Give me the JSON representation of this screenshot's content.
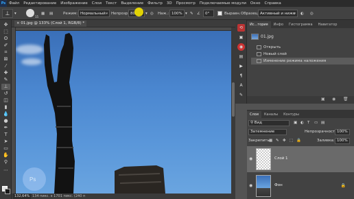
{
  "app": {
    "logo": "Ps"
  },
  "menu": [
    "Файл",
    "Редактирование",
    "Изображение",
    "Слои",
    "Текст",
    "Выделение",
    "Фильтр",
    "3D",
    "Просмотр",
    "Подключаемые модули",
    "Окно",
    "Справка"
  ],
  "options": {
    "brush_size": "15",
    "mode_label": "Режим:",
    "mode_value": "Нормальный",
    "opacity_label": "Непрозр.:",
    "opacity_value": "80",
    "flow_label": "Наж.:",
    "flow_value": "100%",
    "angle_value": "0°",
    "aligned_label": "Выравн.",
    "sample_label": "Образец:",
    "sample_value": "Активный и ниже"
  },
  "document": {
    "tab_title": "01.jpg @ 133% (Слой 1, RGB/8) *",
    "zoom": "132,64%",
    "info": "134 пикс. x 1701 пикс. (240 п"
  },
  "history": {
    "tabs": [
      "Ис...тория",
      "Инфо",
      "Гистограмма",
      "Навигатор"
    ],
    "snapshot": "01.jpg",
    "items": [
      {
        "label": "Открыть",
        "selected": false
      },
      {
        "label": "Новый слой",
        "selected": false
      },
      {
        "label": "Изменение режима наложения",
        "selected": true
      }
    ]
  },
  "layers": {
    "tabs": [
      "Слои",
      "Каналы",
      "Контуры"
    ],
    "filter_value": "Вид",
    "blend_mode": "Затемнение",
    "opacity_label": "Непрозрачность:",
    "opacity_value": "100%",
    "lock_label": "Закрепить:",
    "fill_label": "Заливка:",
    "fill_value": "100%",
    "items": [
      {
        "name": "Слой 1",
        "selected": true
      },
      {
        "name": "Фон",
        "selected": false
      }
    ]
  }
}
